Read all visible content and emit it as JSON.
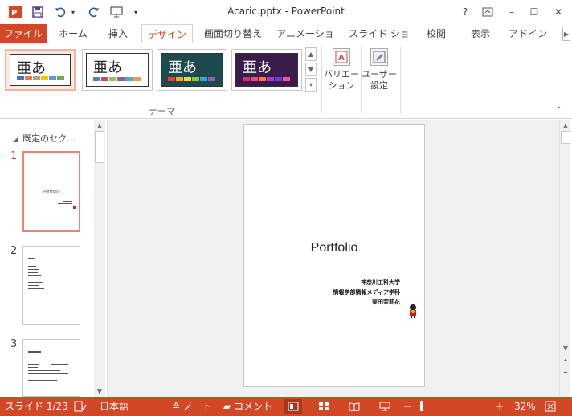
{
  "titlebar": {
    "title": "Acaric.pptx - PowerPoint",
    "help": "?",
    "minimize": "–",
    "maximize": "☐",
    "close": "✕"
  },
  "ribbon": {
    "tabs": [
      {
        "label": "ファイル"
      },
      {
        "label": "ホーム"
      },
      {
        "label": "挿入"
      },
      {
        "label": "デザイン"
      },
      {
        "label": "画面切り替え"
      },
      {
        "label": "アニメーション"
      },
      {
        "label": "スライド ショー"
      },
      {
        "label": "校閲"
      },
      {
        "label": "表示"
      },
      {
        "label": "アドイン"
      }
    ],
    "active_tab": "デザイン",
    "themes": [
      {
        "glyph": "亜あ",
        "bg": "#ffffff",
        "text": "#222222",
        "swatches": [
          "#4472c4",
          "#ed7d31",
          "#a5a5a5",
          "#ffc000",
          "#5b9bd5",
          "#70ad47"
        ]
      },
      {
        "glyph": "亜あ",
        "bg": "#ffffff",
        "text": "#222222",
        "swatches": [
          "#4f81bd",
          "#c0504d",
          "#9bbb59",
          "#8064a2",
          "#4bacc6",
          "#f79646"
        ]
      },
      {
        "glyph": "亜あ",
        "bg": "#1c4a4f",
        "text": "#ffffff",
        "swatches": [
          "#e3412a",
          "#f5a623",
          "#f8d23a",
          "#8cc63f",
          "#35a8c9",
          "#9b59b6"
        ]
      },
      {
        "glyph": "亜あ",
        "bg": "#3a1b4a",
        "text": "#ffffff",
        "swatches": [
          "#e0277a",
          "#e94f6b",
          "#f07f3c",
          "#a23ed0",
          "#6b3fd6",
          "#ff4fa0"
        ]
      }
    ],
    "group_label": "テーマ",
    "variation_label_1": "バリエー",
    "variation_label_2": "ション",
    "custom_label_1": "ユーザー",
    "custom_label_2": "設定"
  },
  "thumbs": {
    "section_label": "既定のセク…",
    "slides": [
      {
        "number": "1",
        "title": "Portfolio"
      },
      {
        "number": "2"
      },
      {
        "number": "3"
      }
    ]
  },
  "slide": {
    "title": "Portfolio",
    "lines": [
      "神奈川工科大学",
      "情報学部情報メディア学科",
      "栗田茉莉花"
    ]
  },
  "statusbar": {
    "slide_info": "スライド 1/23",
    "language": "日本語",
    "notes": "ノート",
    "comments": "コメント",
    "zoom": "32%"
  },
  "colors": {
    "accent": "#d24726"
  }
}
